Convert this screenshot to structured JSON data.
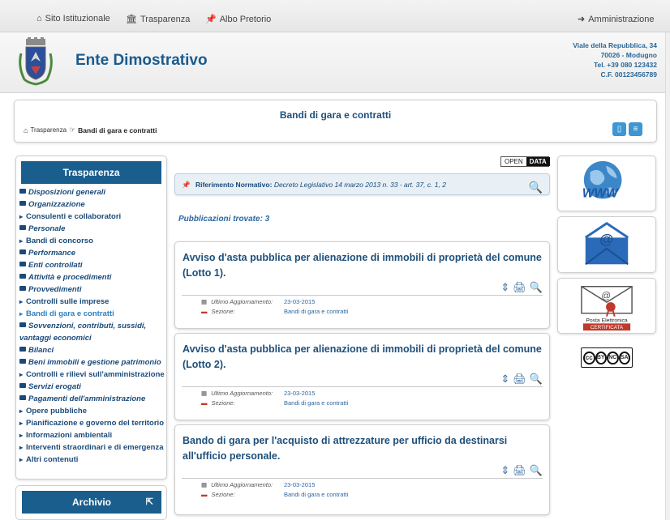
{
  "topbar": {
    "links": [
      {
        "label": "Sito Istituzionale",
        "icon": "home-icon"
      },
      {
        "label": "Trasparenza",
        "icon": "institution-icon"
      },
      {
        "label": "Albo Pretorio",
        "icon": "pin-icon"
      }
    ],
    "admin": {
      "label": "Amministrazione",
      "icon": "login-icon"
    }
  },
  "header": {
    "site_name": "Ente Dimostrativo",
    "address": {
      "street": "Viale della Repubblica, 34",
      "city": "70026 - Modugno",
      "phone": "Tel. +39 080 123432",
      "fiscal": "C.F. 00123456789"
    }
  },
  "title_box": {
    "title": "Bandi di gara e contratti",
    "breadcrumb_root": "Trasparenza",
    "breadcrumb_current": "Bandi di gara e contratti"
  },
  "sidebar": {
    "title": "Trasparenza",
    "items": [
      {
        "label": "Disposizioni generali",
        "type": "folder"
      },
      {
        "label": "Organizzazione",
        "type": "folder"
      },
      {
        "label": "Consulenti e collaboratori",
        "type": "link"
      },
      {
        "label": "Personale",
        "type": "folder"
      },
      {
        "label": "Bandi di concorso",
        "type": "link"
      },
      {
        "label": "Performance",
        "type": "folder"
      },
      {
        "label": "Enti controllati",
        "type": "folder"
      },
      {
        "label": "Attività e procedimenti",
        "type": "folder"
      },
      {
        "label": "Provvedimenti",
        "type": "folder"
      },
      {
        "label": "Controlli sulle imprese",
        "type": "link"
      },
      {
        "label": "Bandi di gara e contratti",
        "type": "link",
        "active": true
      },
      {
        "label": "Sovvenzioni, contributi, sussidi, vantaggi economici",
        "type": "folder"
      },
      {
        "label": "Bilanci",
        "type": "folder"
      },
      {
        "label": "Beni immobili e gestione patrimonio",
        "type": "folder"
      },
      {
        "label": "Controlli e rilievi sull'amministrazione",
        "type": "link"
      },
      {
        "label": "Servizi erogati",
        "type": "folder"
      },
      {
        "label": "Pagamenti dell'amministrazione",
        "type": "folder"
      },
      {
        "label": "Opere pubbliche",
        "type": "link"
      },
      {
        "label": "Pianificazione e governo del territorio",
        "type": "link"
      },
      {
        "label": "Informazioni ambientali",
        "type": "link"
      },
      {
        "label": "Interventi straordinari e di emergenza",
        "type": "link"
      },
      {
        "label": "Altri contenuti",
        "type": "link"
      }
    ],
    "archive_title": "Archivio"
  },
  "main": {
    "opendata": {
      "open": "OPEN",
      "data": "DATA"
    },
    "riferimento": {
      "label": "Riferimento Normativo:",
      "value": "Decreto Legislativo 14 marzo 2013 n. 33 - art. 37, c. 1, 2"
    },
    "found": "Pubblicazioni trovate: 3",
    "cards": [
      {
        "title": "Avviso d'asta pubblica per alienazione di immobili di proprietà del comune (Lotto 1).",
        "updated_label": "Ultimo Aggiornamento:",
        "updated": "23-03-2015",
        "section_label": "Sezione:",
        "section": "Bandi di gara e contratti"
      },
      {
        "title": "Avviso d'asta pubblica per alienazione di immobili di proprietà del comune (Lotto 2).",
        "updated_label": "Ultimo Aggiornamento:",
        "updated": "23-03-2015",
        "section_label": "Sezione:",
        "section": "Bandi di gara e contratti"
      },
      {
        "title": "Bando di gara per l'acquisto di attrezzature per ufficio da destinarsi all'ufficio personale.",
        "updated_label": "Ultimo Aggiornamento:",
        "updated": "23-03-2015",
        "section_label": "Sezione:",
        "section": "Bandi di gara e contratti"
      }
    ]
  },
  "right": {
    "www_text": "WWW",
    "pec_line1": "Posta Elettronica",
    "pec_line2": "CERTIFICATA",
    "cc_labels": [
      "BY",
      "NC",
      "SA"
    ]
  },
  "colors": {
    "brand_blue": "#1a5e8e",
    "title_blue": "#1e4f7a",
    "link_blue": "#2a67a0",
    "button_blue": "#3e96d3"
  }
}
